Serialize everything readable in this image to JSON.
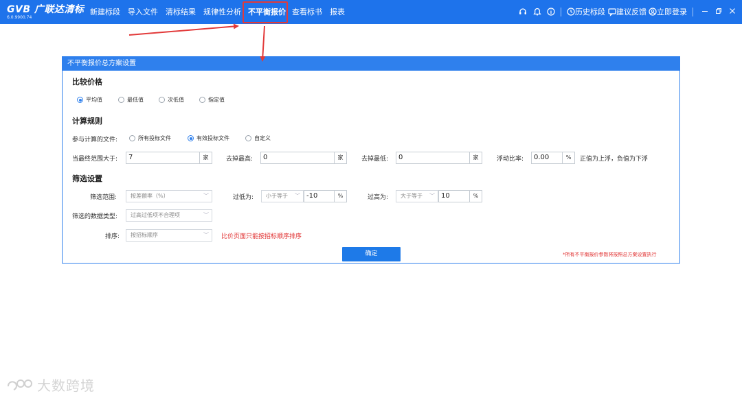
{
  "app": {
    "logo_text": "GVB 广联达清标",
    "version": "6.0.9900.74"
  },
  "nav": {
    "items": [
      "新建标段",
      "导入文件",
      "清标结果",
      "规律性分析",
      "不平衡报价",
      "查看标书",
      "报表"
    ],
    "active": "不平衡报价"
  },
  "toolbar": {
    "history_label": "历史标段",
    "feedback_label": "建议反馈",
    "login_label": "立即登录"
  },
  "icons": {
    "headset": "headset-icon",
    "bell": "bell-icon",
    "info": "info-icon",
    "history": "clock-icon",
    "feedback": "chat-icon",
    "login": "user-icon",
    "minimize": "minimize-icon",
    "restore": "restore-icon",
    "close": "close-icon"
  },
  "colors": {
    "brand_blue": "#1e73eb",
    "dialog_blue": "#2f80ed",
    "annotation_red": "#e23a3a",
    "warning_red": "#e03030"
  },
  "dialog": {
    "title": "不平衡报价总方案设置",
    "compare_price": {
      "title": "比较价格",
      "options": [
        "平均值",
        "最低值",
        "次低值",
        "指定值"
      ],
      "selected": "平均值"
    },
    "calc_rules": {
      "title": "计算规则",
      "files_label": "参与计算的文件:",
      "file_options": [
        "所有投标文件",
        "有效投标文件",
        "自定义"
      ],
      "file_selected": "有效投标文件",
      "range_label": "当最终范围大于:",
      "range_value": "7",
      "range_unit": "家",
      "remove_high_label": "去掉最高:",
      "remove_high_value": "0",
      "remove_high_unit": "家",
      "remove_low_label": "去掉最低:",
      "remove_low_value": "0",
      "remove_low_unit": "家",
      "float_label": "浮动比率:",
      "float_value": "0.00",
      "float_unit": "%",
      "float_hint": "正值为上浮，负值为下浮"
    },
    "filter": {
      "title": "筛选设置",
      "range_label": "筛选范围:",
      "range_select": "按差额率（%）",
      "too_low_label": "过低为:",
      "too_low_op": "小于等于",
      "too_low_value": "-10",
      "too_low_unit": "%",
      "too_high_label": "过高为:",
      "too_high_op": "大于等于",
      "too_high_value": "10",
      "too_high_unit": "%",
      "data_type_label": "筛选的数据类型:",
      "data_type_select": "过高过低项不合理项",
      "sort_label": "排序:",
      "sort_select": "按招标顺序",
      "sort_note": "比价页面只能按招标顺序排序"
    },
    "ok_label": "确定",
    "footnote": "*所有不平衡报价参数将按照总方案设置执行"
  },
  "watermark": {
    "text": "大数跨境"
  }
}
